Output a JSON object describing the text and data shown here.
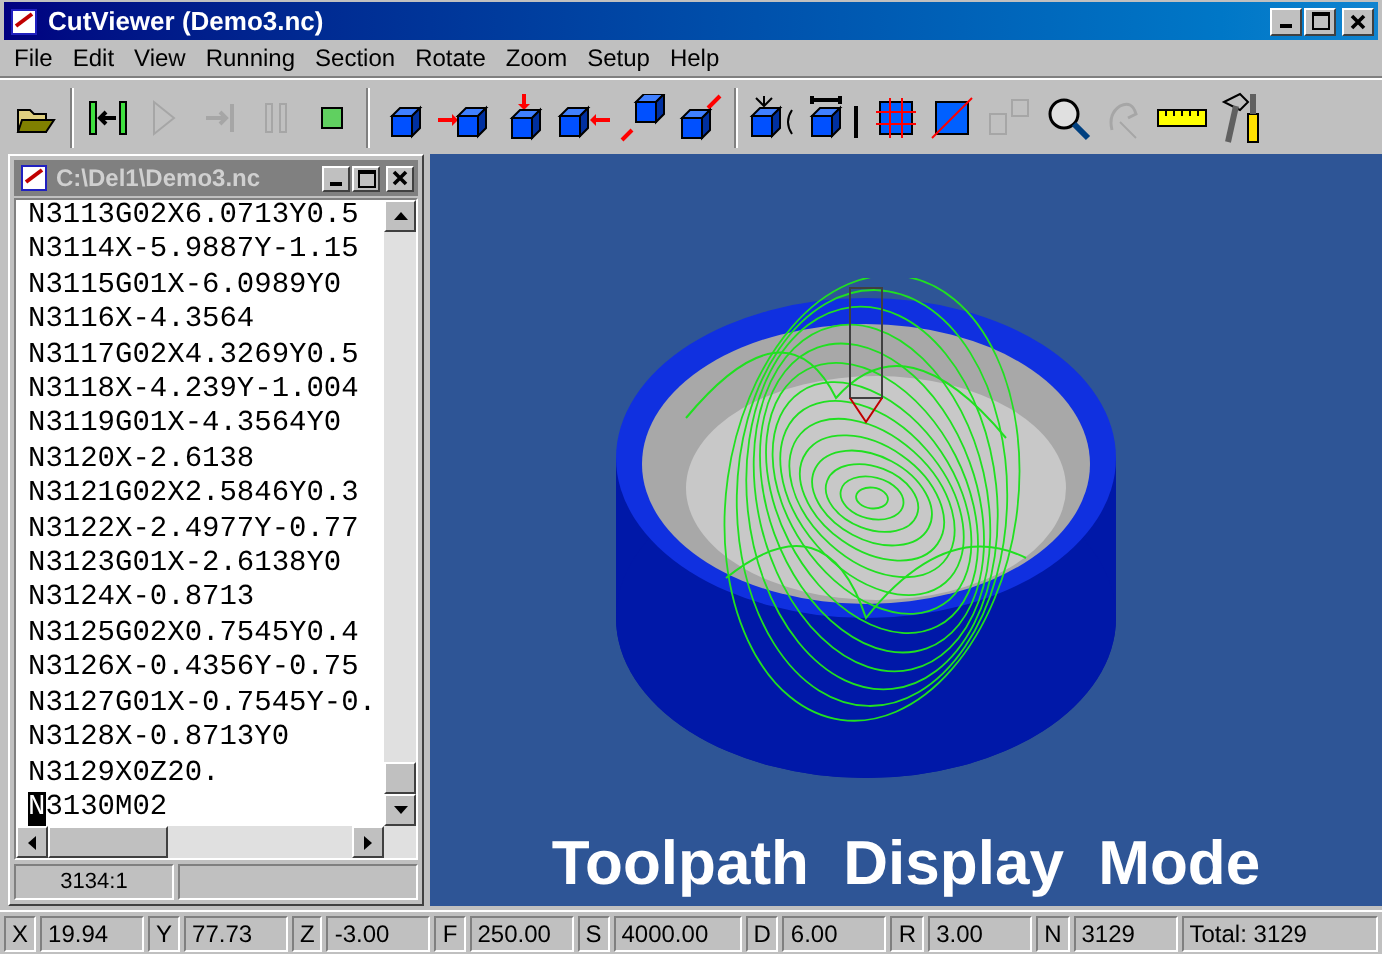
{
  "window": {
    "title": "CutViewer (Demo3.nc)"
  },
  "menu": [
    "File",
    "Edit",
    "View",
    "Running",
    "Section",
    "Rotate",
    "Zoom",
    "Setup",
    "Help"
  ],
  "toolbar": [
    [
      {
        "kind": "open",
        "disabled": false
      }
    ],
    [
      {
        "kind": "rewind",
        "disabled": false
      },
      {
        "kind": "play",
        "disabled": true
      },
      {
        "kind": "step",
        "disabled": true
      },
      {
        "kind": "pause",
        "disabled": true
      },
      {
        "kind": "stop",
        "disabled": false
      }
    ],
    [
      {
        "kind": "cube",
        "disabled": false
      },
      {
        "kind": "cube-left",
        "disabled": false
      },
      {
        "kind": "cube-top",
        "disabled": false
      },
      {
        "kind": "cube-right",
        "disabled": false
      },
      {
        "kind": "cube-diag",
        "disabled": false
      },
      {
        "kind": "cube-diag2",
        "disabled": false
      }
    ],
    [
      {
        "kind": "rotate",
        "disabled": false
      },
      {
        "kind": "fit",
        "disabled": false
      },
      {
        "kind": "grid",
        "disabled": false
      },
      {
        "kind": "section",
        "disabled": false
      },
      {
        "kind": "compare",
        "disabled": true
      },
      {
        "kind": "zoom",
        "disabled": false
      },
      {
        "kind": "pan",
        "disabled": true
      },
      {
        "kind": "ruler",
        "disabled": false
      },
      {
        "kind": "tools",
        "disabled": false
      }
    ]
  ],
  "editor": {
    "title": "C:\\Del1\\Demo3.nc",
    "lines": [
      "N3113G02X6.0713Y0.5",
      "N3114X-5.9887Y-1.15",
      "N3115G01X-6.0989Y0",
      "N3116X-4.3564",
      "N3117G02X4.3269Y0.5",
      "N3118X-4.239Y-1.004",
      "N3119G01X-4.3564Y0",
      "N3120X-2.6138",
      "N3121G02X2.5846Y0.3",
      "N3122X-2.4977Y-0.77",
      "N3123G01X-2.6138Y0",
      "N3124X-0.8713",
      "N3125G02X0.7545Y0.4",
      "N3126X-0.4356Y-0.75",
      "N3127G01X-0.7545Y-0.",
      "N3128X-0.8713Y0",
      "N3129X0Z20."
    ],
    "cursor_line": "N",
    "cursor_rest": "3130M02",
    "position": "3134:1"
  },
  "viewport": {
    "caption": "Toolpath  Display  Mode"
  },
  "status_bar": [
    {
      "label": "X",
      "value": "19.94"
    },
    {
      "label": "Y",
      "value": "77.73"
    },
    {
      "label": "Z",
      "value": "-3.00"
    },
    {
      "label": "F",
      "value": "250.00"
    },
    {
      "label": "S",
      "value": "4000.00"
    },
    {
      "label": "D",
      "value": "6.00"
    },
    {
      "label": "R",
      "value": "3.00"
    },
    {
      "label": "N",
      "value": "3129"
    }
  ],
  "total": "Total: 3129"
}
